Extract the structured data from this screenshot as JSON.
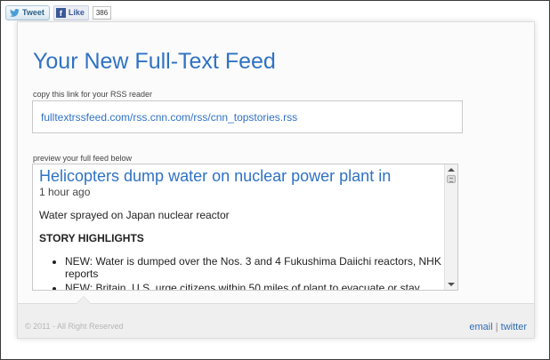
{
  "social": {
    "tweet_label": "Tweet",
    "like_label": "Like",
    "like_count": "386"
  },
  "header": {
    "title": "Your New Full-Text Feed"
  },
  "rss": {
    "label": "copy this link for your RSS reader",
    "link": "fulltextrssfeed.com/rss.cnn.com/rss/cnn_topstories.rss"
  },
  "preview": {
    "label": "preview your full feed below",
    "article": {
      "title": "Helicopters dump water on nuclear power plant in",
      "time": "1 hour ago",
      "summary": "Water sprayed on Japan nuclear reactor",
      "highlights_heading": "STORY HIGHLIGHTS",
      "highlights": [
        "NEW: Water is dumped over the Nos. 3 and 4 Fukushima Daiichi reactors, NHK reports",
        "NEW: Britain, U.S. urge citizens within 50 miles of plant to evacuate or stay"
      ]
    }
  },
  "footer": {
    "copyright": "© 2011 - All Right Reserved",
    "email_label": "email",
    "separator": "|",
    "twitter_label": "twitter"
  },
  "colors": {
    "accent_blue": "#2f72c4",
    "facebook_blue": "#3b5998",
    "footer_gray": "#efefef"
  },
  "icons": {
    "tweet": "twitter-bird-icon",
    "like": "facebook-f-icon"
  }
}
